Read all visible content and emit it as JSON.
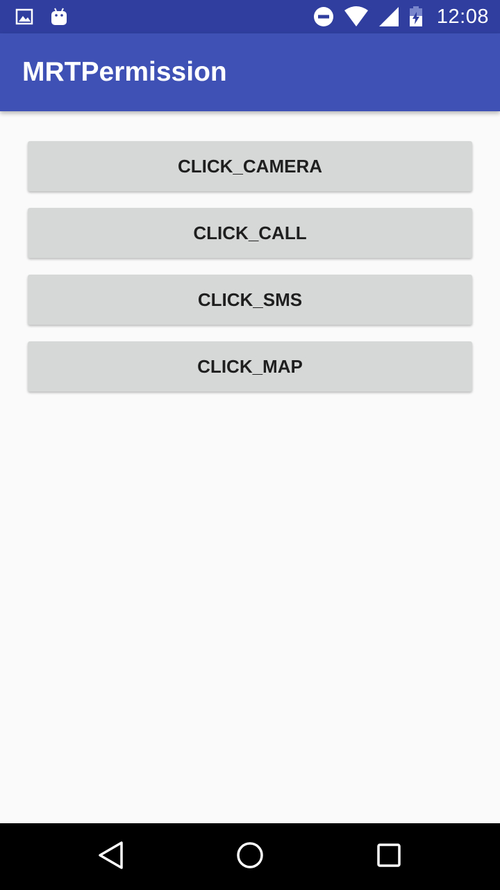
{
  "status_bar": {
    "time": "12:08",
    "left_icons": [
      "image-notification-icon",
      "android-notification-icon"
    ],
    "right_icons": [
      "do-not-disturb-icon",
      "wifi-icon",
      "cellular-signal-icon",
      "battery-charging-icon"
    ]
  },
  "app_bar": {
    "title": "MRTPermission"
  },
  "buttons": [
    {
      "label": "CLICK_CAMERA"
    },
    {
      "label": "CLICK_CALL"
    },
    {
      "label": "CLICK_SMS"
    },
    {
      "label": "CLICK_MAP"
    }
  ],
  "nav_bar": {
    "icons": [
      "back-icon",
      "home-icon",
      "recents-icon"
    ]
  },
  "colors": {
    "status_bar": "#303f9f",
    "app_bar": "#3f51b5",
    "background": "#fafafa",
    "button": "#d6d7d7",
    "nav_bar": "#000000"
  }
}
